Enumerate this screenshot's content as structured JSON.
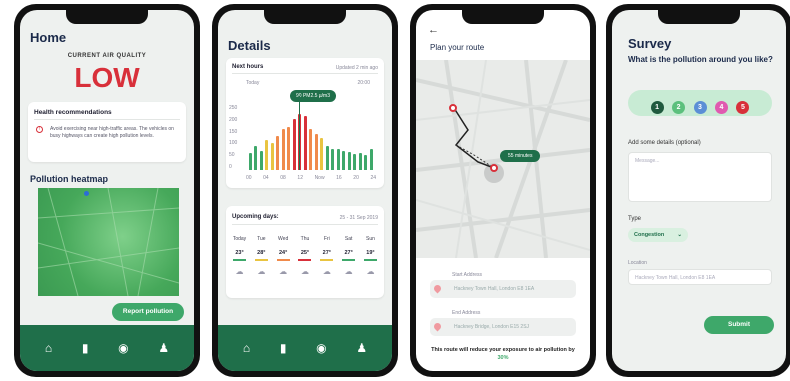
{
  "home": {
    "title": "Home",
    "aq_label": "CURRENT AIR QUALITY",
    "aq_value": "LOW",
    "health_title": "Health recommendations",
    "health_text": "Avoid exercising near high-traffic areas. The vehicles on busy highways can create high pollution levels.",
    "heatmap_title": "Pollution heatmap",
    "report_button": "Report pollution"
  },
  "details": {
    "title": "Details",
    "next_hours": "Next hours",
    "updated": "Updated 2 min ago",
    "today": "Today",
    "time_right": "20:00",
    "tooltip": "90 PM2.5 µ/m3",
    "y_ticks": [
      "250",
      "200",
      "150",
      "100",
      "50",
      "0"
    ],
    "x_ticks": [
      "00",
      "04",
      "08",
      "12",
      "Now",
      "16",
      "20",
      "24"
    ],
    "bar_values": [
      40,
      55,
      45,
      70,
      62,
      80,
      95,
      100,
      120,
      130,
      125,
      95,
      85,
      75,
      55,
      50,
      48,
      45,
      42,
      38,
      40,
      36,
      50
    ],
    "upcoming_title": "Upcoming days:",
    "date_range": "25 - 31 Sep 2019",
    "days": [
      {
        "day": "Today",
        "temp": "23°"
      },
      {
        "day": "Tue",
        "temp": "28°"
      },
      {
        "day": "Wed",
        "temp": "24°"
      },
      {
        "day": "Thu",
        "temp": "25°"
      },
      {
        "day": "Fri",
        "temp": "27°"
      },
      {
        "day": "Sat",
        "temp": "27°"
      },
      {
        "day": "Sun",
        "temp": "19°"
      }
    ]
  },
  "route": {
    "title": "Plan your route",
    "eta": "55 minutes",
    "start_label": "Start Address",
    "start_value": "Hackney Town Hall, London E8 1EA",
    "end_label": "End Address",
    "end_value": "Hackney Bridge, London E15 2SJ",
    "note": "This route will reduce your exposure to air pollution by",
    "note_pct": "30%"
  },
  "survey": {
    "title": "Survey",
    "question": "What is the pollution around you like?",
    "options": [
      "1",
      "2",
      "3",
      "4",
      "5"
    ],
    "details_label": "Add some details (optional)",
    "message_placeholder": "Message...",
    "type_label": "Type",
    "type_value": "Congestion",
    "location_label": "Location",
    "location_value": "Hackney Town Hall, London E8 1EA",
    "submit": "Submit"
  },
  "colors": {
    "brand_green": "#1f6f4a",
    "accent_green": "#3ea86a",
    "alert_red": "#d8303a"
  },
  "icons": [
    "home-icon",
    "chart-icon",
    "compass-icon",
    "person-icon",
    "back-arrow-icon",
    "pin-icon",
    "warning-icon",
    "chevron-down-icon"
  ]
}
